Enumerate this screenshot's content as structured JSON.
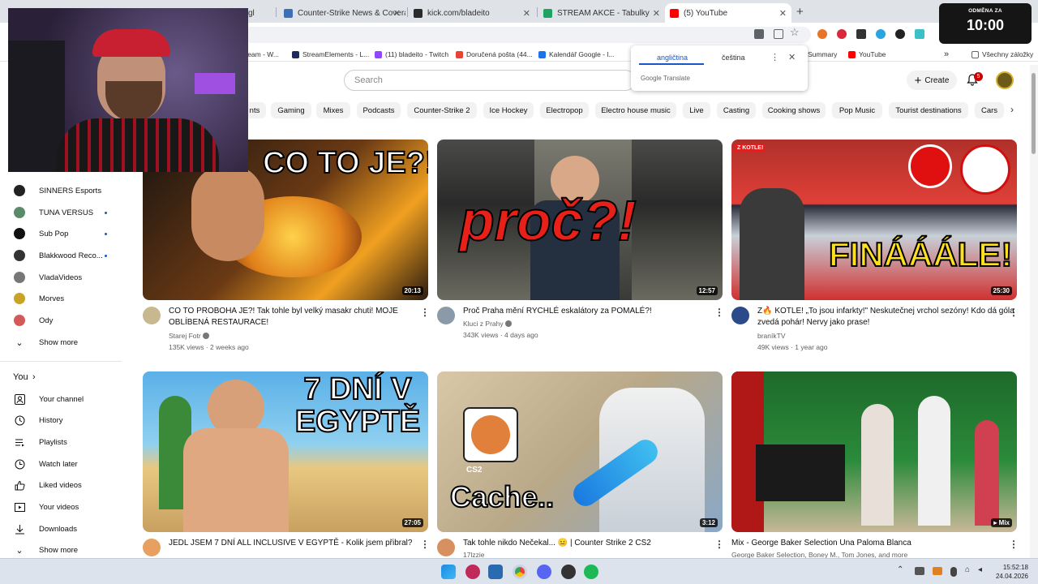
{
  "browser": {
    "tabs": [
      {
        "label": "Counter-Strike News & Covera",
        "color": "#3b6fb6"
      },
      {
        "label": "kick.com/bladeito",
        "color": "#2a2a2a"
      },
      {
        "label": "STREAM AKCE - Tabulky Google",
        "color": "#1ea362"
      },
      {
        "label": "(5) YouTube",
        "color": "#ff0000"
      }
    ],
    "partial_tab": "gl",
    "new_tab": "+",
    "bookmarks": [
      {
        "label": "tream - W...",
        "color": "#888888"
      },
      {
        "label": "StreamElements - L...",
        "color": "#1e2a5a"
      },
      {
        "label": "(11) bladeito - Twitch",
        "color": "#9146ff"
      },
      {
        "label": "Doručená pošta (44...",
        "color": "#ea4335"
      },
      {
        "label": "Kalendář Google - l...",
        "color": "#1a73e8"
      },
      {
        "label": "Summary",
        "color": "#888888"
      },
      {
        "label": "YouTube",
        "color": "#ff0000"
      },
      {
        "label": "Všechny záložky",
        "color": "#666666"
      }
    ]
  },
  "timer": {
    "label": "ODMĚNA ZA",
    "value": "10:00"
  },
  "translate": {
    "lang_from": "angličtina",
    "lang_to": "čeština",
    "brand": "Google Translate"
  },
  "youtube": {
    "search_placeholder": "Search",
    "create_label": "Create",
    "notification_count": "5",
    "chips": [
      "nts",
      "Gaming",
      "Mixes",
      "Podcasts",
      "Counter-Strike 2",
      "Ice Hockey",
      "Electropop",
      "Electro house music",
      "Live",
      "Casting",
      "Cooking shows",
      "Pop Music",
      "Tourist destinations",
      "Cars"
    ]
  },
  "sidebar": {
    "subscriptions": [
      {
        "label": "SINNERS Esports",
        "color": "#222222"
      },
      {
        "label": "TUNA VERSUS",
        "color": "#5a8a6a"
      },
      {
        "label": "Sub Pop",
        "color": "#111111"
      },
      {
        "label": "Blakkwood Reco...",
        "color": "#333333"
      },
      {
        "label": "VladaVideos",
        "color": "#777777"
      },
      {
        "label": "Morves",
        "color": "#c9a227"
      },
      {
        "label": "Ody",
        "color": "#d45a5a"
      }
    ],
    "show_more": "Show more",
    "you_label": "You",
    "you_items": [
      "Your channel",
      "History",
      "Playlists",
      "Watch later",
      "Liked videos",
      "Your videos",
      "Downloads"
    ],
    "show_more_2": "Show more"
  },
  "videos": [
    {
      "thumb_text": "CO TO JE?!",
      "duration": "20:13",
      "title": "CO TO PROBOHA JE?! Tak tohle byl velký masakr chuti! MOJE OBLÍBENÁ RESTAURACE!",
      "channel": "Starej Fotr",
      "verified": true,
      "meta": "135K views · 2 weeks ago"
    },
    {
      "thumb_text": "proč?!",
      "duration": "12:57",
      "title": "Proč Praha mění RYCHLÉ eskalátory za POMALÉ?!",
      "channel": "Kluci z Prahy",
      "verified": true,
      "meta": "343K views · 4 days ago"
    },
    {
      "thumb_text": "FINÁÁÁLE!",
      "duration": "25:30",
      "title": "Z🔥 KOTLE! „To jsou infarkty!\" Neskutečnej vrchol sezóny! Kdo dá góla zvedá pohár! Nervy jako prase!",
      "channel": "braníkTV",
      "verified": false,
      "meta": "49K views · 1 year ago"
    },
    {
      "thumb_text": "7 DNÍ V EGYPTĚ",
      "duration": "27:05",
      "title": "JEDL JSEM 7 DNÍ ALL INCLUSIVE V EGYPTĚ - Kolik jsem přibral?",
      "channel": "",
      "verified": false,
      "meta": ""
    },
    {
      "thumb_text": "Cache..",
      "duration": "3:12",
      "title": "Tak tohle nikdo Nečekal... 😐 | Counter Strike 2 CS2",
      "channel": "17lzzie",
      "verified": false,
      "meta": ""
    },
    {
      "thumb_text": "Mix",
      "duration": "Mix",
      "title": "Mix - George Baker Selection Una Paloma Blanca",
      "channel": "George Baker Selection, Boney M., Tom Jones, and more",
      "verified": false,
      "meta": ""
    }
  ],
  "taskbar": {
    "time": "15:52:18",
    "date": "24.04.2026"
  }
}
